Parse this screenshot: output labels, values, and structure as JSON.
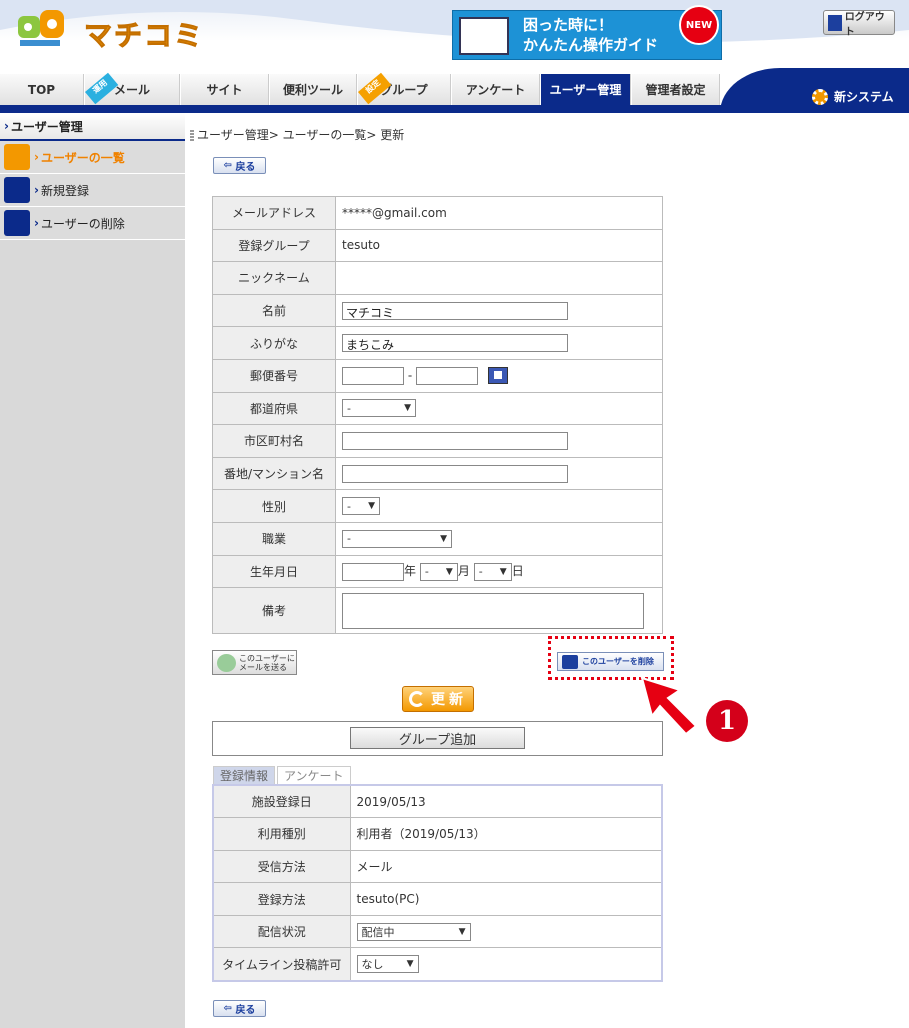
{
  "header": {
    "logo_text": "マチコミ",
    "banner_line1": "困った時に！",
    "banner_line2": "かんたん操作ガイド",
    "banner_badge": "NEW",
    "logout_label": "ログアウト"
  },
  "nav": {
    "tabs": [
      "TOP",
      "メール",
      "サイト",
      "便利ツール",
      "グループ",
      "アンケート",
      "ユーザー管理",
      "管理者設定"
    ],
    "ribbon_mail": "運用",
    "ribbon_group": "設定",
    "new_system_label": "新システム"
  },
  "sidebar": {
    "title": "ユーザー管理",
    "items": [
      "ユーザーの一覧",
      "新規登録",
      "ユーザーの削除"
    ]
  },
  "breadcrumb": "ユーザー管理> ユーザーの一覧> 更新",
  "back_label": "戻る",
  "form": {
    "labels": [
      "メールアドレス",
      "登録グループ",
      "ニックネーム",
      "名前",
      "ふりがな",
      "郵便番号",
      "都道府県",
      "市区町村名",
      "番地/マンション名",
      "性別",
      "職業",
      "生年月日",
      "備考"
    ],
    "email": "*****@gmail.com",
    "group": "tesuto",
    "name": "マチコミ",
    "furigana": "まちこみ",
    "postal_sep": "-",
    "select_default": "-",
    "year_unit": "年",
    "month_unit": "月",
    "day_unit": "日"
  },
  "mail_user_button": "このユーザーにメールを送る",
  "delete_user_button": "このユーザーを削除",
  "callout_number": "1",
  "update_button": "更新",
  "group_add_button": "グループ追加",
  "info_tabs": [
    "登録情報",
    "アンケート"
  ],
  "info": {
    "rows": [
      {
        "label": "施設登録日",
        "value": "2019/05/13"
      },
      {
        "label": "利用種別",
        "value": "利用者（2019/05/13）"
      },
      {
        "label": "受信方法",
        "value": "メール"
      },
      {
        "label": "登録方法",
        "value": "tesuto(PC)"
      },
      {
        "label": "配信状況",
        "value": "配信中"
      },
      {
        "label": "タイムライン投稿許可",
        "value": "なし"
      }
    ]
  },
  "colors": {
    "brand_navy": "#0b2a8a",
    "accent_orange": "#f39800",
    "alert_red": "#e60012"
  }
}
